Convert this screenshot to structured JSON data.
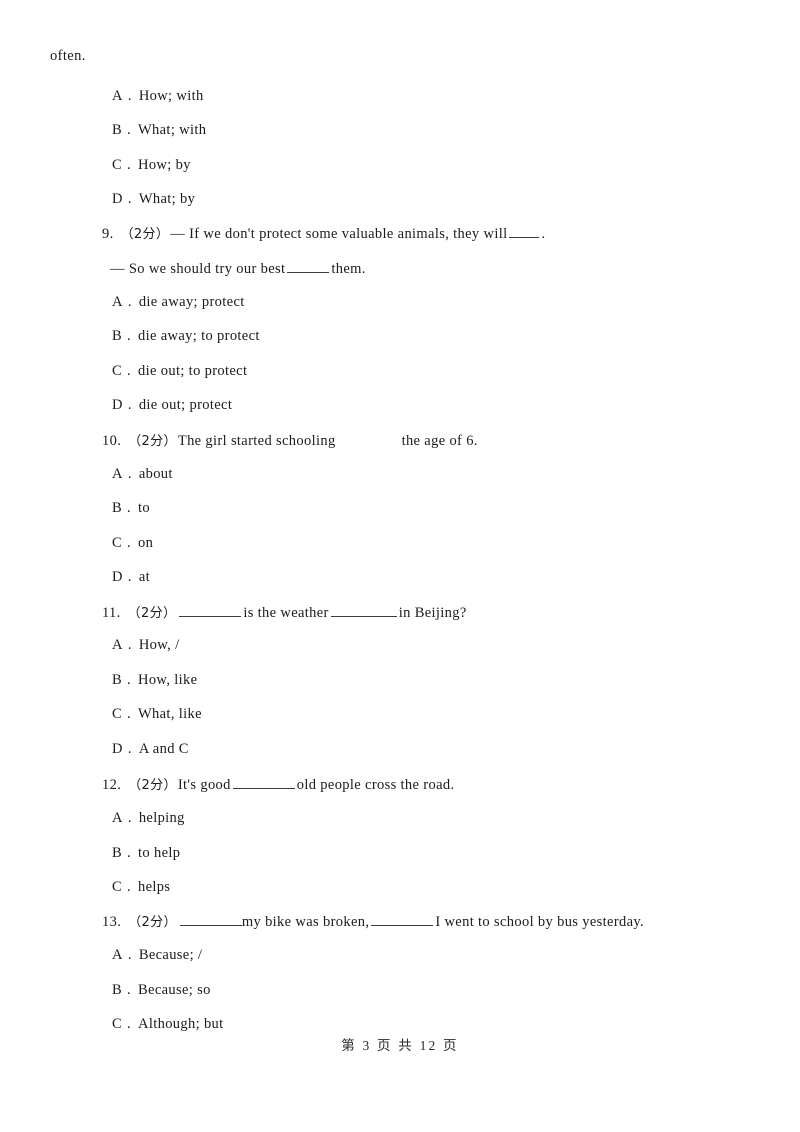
{
  "document": {
    "continued_text": "often.",
    "footer": "第 3 页 共 12 页"
  },
  "questions": [
    {
      "number": "",
      "marks": "",
      "stem_parts": [],
      "options": [
        {
          "letter": "A",
          "dot": ".",
          "text": "How; with"
        },
        {
          "letter": "B",
          "dot": ".",
          "text": "What; with"
        },
        {
          "letter": "C",
          "dot": ".",
          "text": "How; by"
        },
        {
          "letter": "D",
          "dot": ".",
          "text": "What; by"
        }
      ]
    },
    {
      "number": "9.",
      "marks": "（2分）",
      "stem": "— If we don't protect some valuable animals, they will ____ .",
      "stem_a": "— If we don't protect some valuable animals, they will",
      "stem_a_tail": ".",
      "stem_b_prefix": "— So we should try our best",
      "stem_b_suffix": "them.",
      "options": [
        {
          "letter": "A",
          "dot": ".",
          "text": "die away; protect"
        },
        {
          "letter": "B",
          "dot": ".",
          "text": "die away; to protect"
        },
        {
          "letter": "C",
          "dot": ".",
          "text": "die out; to protect"
        },
        {
          "letter": "D",
          "dot": ".",
          "text": "die out; protect"
        }
      ]
    },
    {
      "number": "10.",
      "marks": "（2分）",
      "stem_prefix": "The girl started schooling",
      "stem_suffix": "the age of 6.",
      "options": [
        {
          "letter": "A",
          "dot": ".",
          "text": "about"
        },
        {
          "letter": "B",
          "dot": ".",
          "text": "to"
        },
        {
          "letter": "C",
          "dot": ".",
          "text": "on"
        },
        {
          "letter": "D",
          "dot": ".",
          "text": "at"
        }
      ]
    },
    {
      "number": "11.",
      "marks": "（2分）",
      "stem_mid": "is the weather",
      "stem_end": "in Beijing?",
      "options": [
        {
          "letter": "A",
          "dot": ".",
          "text": "How, /"
        },
        {
          "letter": "B",
          "dot": ".",
          "text": "How, like"
        },
        {
          "letter": "C",
          "dot": ".",
          "text": "What, like"
        },
        {
          "letter": "D",
          "dot": ".",
          "text": "A and C"
        }
      ]
    },
    {
      "number": "12.",
      "marks": "（2分）",
      "stem_prefix": "It's good",
      "stem_suffix": "old people cross the road.",
      "options": [
        {
          "letter": "A",
          "dot": ".",
          "text": "helping"
        },
        {
          "letter": "B",
          "dot": ".",
          "text": "to help"
        },
        {
          "letter": "C",
          "dot": ".",
          "text": "helps"
        }
      ]
    },
    {
      "number": "13.",
      "marks": "（2分）",
      "stem_mid": "my bike was broken,",
      "stem_end": "I went to school by bus yesterday.",
      "options": [
        {
          "letter": "A",
          "dot": ".",
          "text": "Because; /"
        },
        {
          "letter": "B",
          "dot": ".",
          "text": "Because; so"
        },
        {
          "letter": "C",
          "dot": ".",
          "text": "Although; but"
        }
      ]
    }
  ]
}
